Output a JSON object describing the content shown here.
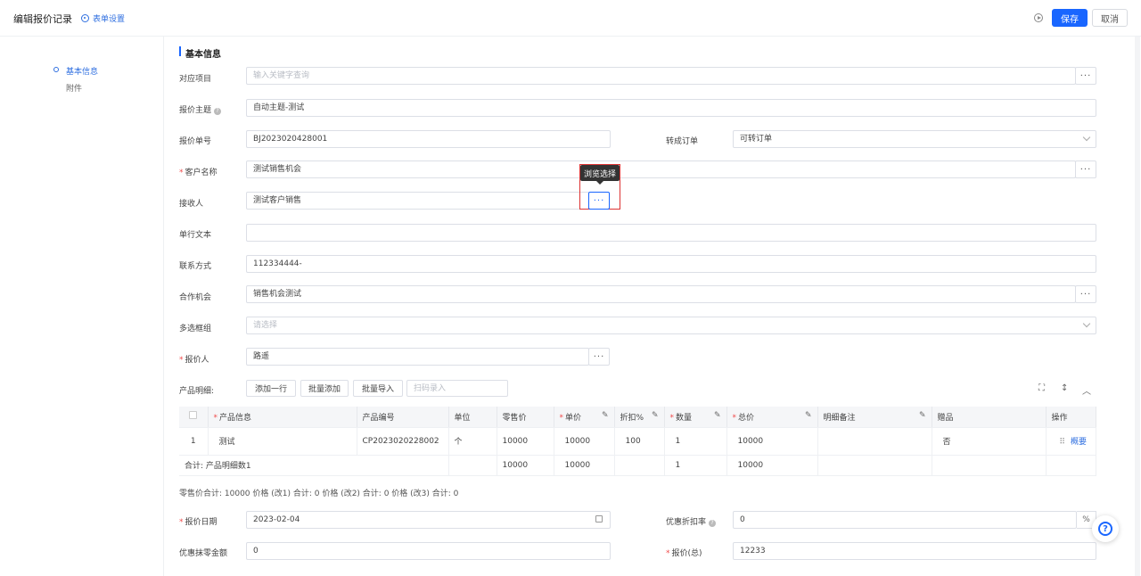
{
  "header": {
    "title": "编辑报价记录",
    "form_settings": "表单设置",
    "save": "保存",
    "cancel": "取消"
  },
  "nav": {
    "items": [
      {
        "label": "基本信息",
        "active": true
      },
      {
        "label": "附件",
        "active": false
      }
    ]
  },
  "section": {
    "title": "基本信息"
  },
  "form": {
    "project": {
      "label": "对应项目",
      "placeholder": "输入关键字查询"
    },
    "subject": {
      "label": "报价主题",
      "value": "自动主题-测试"
    },
    "quote_no": {
      "label": "报价单号",
      "value": "BJ2023020428001"
    },
    "convert_order": {
      "label": "转成订单",
      "value": "可转订单"
    },
    "customer": {
      "label": "客户名称",
      "value": "测试销售机会"
    },
    "receiver": {
      "label": "接收人",
      "value": "测试客户销售"
    },
    "single_text": {
      "label": "单行文本",
      "value": ""
    },
    "contact": {
      "label": "联系方式",
      "value": "112334444-"
    },
    "opportunity": {
      "label": "合作机会",
      "value": "销售机会测试"
    },
    "multi_select": {
      "label": "多选框组",
      "placeholder": "请选择"
    },
    "quoter": {
      "label": "报价人",
      "value": "路遥"
    },
    "quote_date": {
      "label": "报价日期",
      "value": "2023-02-04"
    },
    "discount_rate": {
      "label": "优惠折扣率",
      "value": "0",
      "unit": "%"
    },
    "round_off": {
      "label": "优惠抹零金额",
      "value": "0"
    },
    "total": {
      "label": "报价(总)",
      "value": "12233"
    }
  },
  "tooltip": "浏览选择",
  "products": {
    "label": "产品明细:",
    "add_row": "添加一行",
    "batch_add": "批量添加",
    "batch_import": "批量导入",
    "scan_placeholder": "扫码录入",
    "columns": [
      "产品信息",
      "产品编号",
      "单位",
      "零售价",
      "单价",
      "折扣%",
      "数量",
      "总价",
      "明细备注",
      "赠品",
      "操作"
    ],
    "row": {
      "index": "1",
      "info": "测试",
      "code": "CP2023020228002",
      "unit": "个",
      "retail": "10000",
      "price": "10000",
      "discount": "100",
      "qty": "1",
      "total": "10000",
      "note": "",
      "gift": "否",
      "action": "概要"
    },
    "sum": {
      "label": "合计: 产品明细数1",
      "retail": "10000",
      "price": "10000",
      "qty": "1",
      "total": "10000"
    }
  },
  "summary": "零售价合计: 10000 价格 (改1) 合计: 0 价格 (改2) 合计: 0 价格 (改3) 合计: 0",
  "colors": {
    "accent": "#1966ff",
    "required": "#f04b4b",
    "highlight": "#dd3333"
  }
}
